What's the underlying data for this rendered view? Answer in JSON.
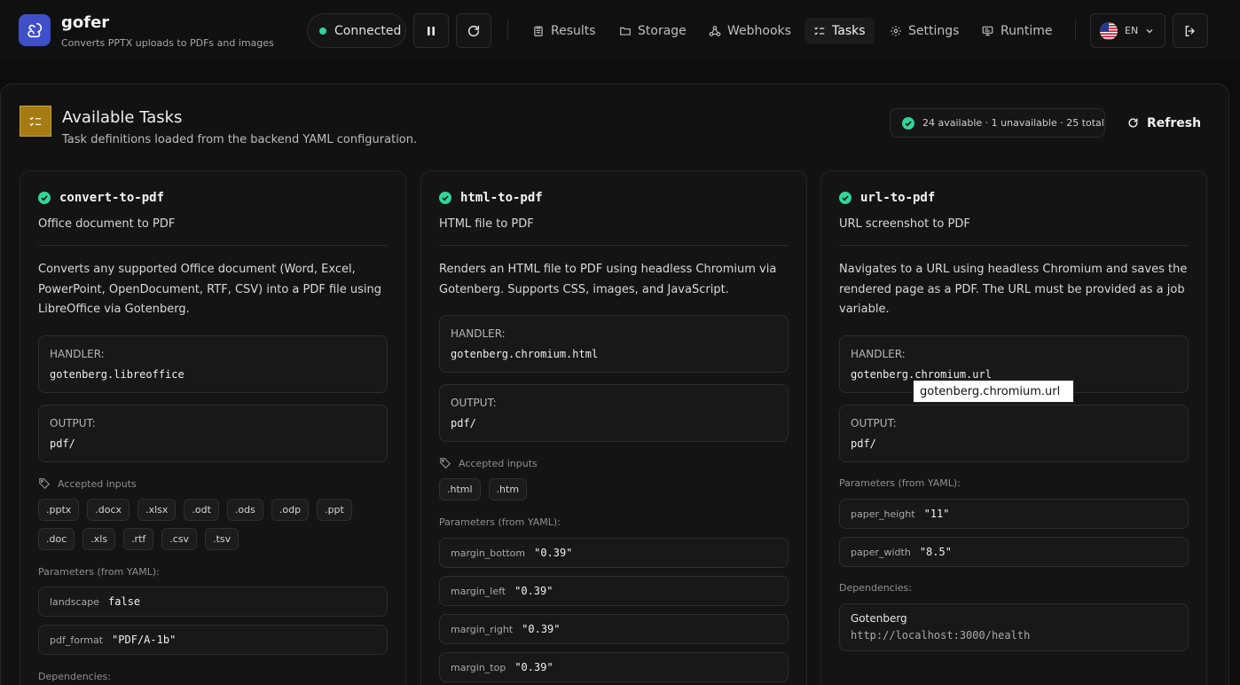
{
  "app": {
    "title": "gofer",
    "subtitle": "Converts PPTX uploads to PDFs and images"
  },
  "status": {
    "label": "Connected",
    "color": "#34d399"
  },
  "nav": [
    {
      "label": "Results",
      "icon": "clipboard-icon"
    },
    {
      "label": "Storage",
      "icon": "folder-icon"
    },
    {
      "label": "Webhooks",
      "icon": "webhook-icon"
    },
    {
      "label": "Tasks",
      "icon": "list-check-icon",
      "active": true
    },
    {
      "label": "Settings",
      "icon": "gear-icon"
    },
    {
      "label": "Runtime",
      "icon": "monitor-icon"
    }
  ],
  "language": {
    "code": "EN"
  },
  "section": {
    "title": "Available Tasks",
    "description": "Task definitions loaded from the backend YAML configuration.",
    "summary": "24 available · 1 unavailable · 25 total",
    "refresh_label": "Refresh",
    "accent": "#a47c13"
  },
  "labels": {
    "handler": "HANDLER:",
    "output": "OUTPUT:",
    "accepted_inputs": "Accepted inputs",
    "parameters": "Parameters (from YAML):",
    "dependencies": "Dependencies:"
  },
  "tasks": [
    {
      "name": "convert-to-pdf",
      "subtitle": "Office document to PDF",
      "description": "Converts any supported Office document (Word, Excel, PowerPoint, OpenDocument, RTF, CSV) into a PDF file using LibreOffice via Gotenberg.",
      "handler": "gotenberg.libreoffice",
      "output": "pdf/",
      "inputs": [
        ".pptx",
        ".docx",
        ".xlsx",
        ".odt",
        ".ods",
        ".odp",
        ".ppt",
        ".doc",
        ".xls",
        ".rtf",
        ".csv",
        ".tsv"
      ],
      "parameters": [
        {
          "key": "landscape",
          "value": "false"
        },
        {
          "key": "pdf_format",
          "value": "\"PDF/A-1b\""
        }
      ]
    },
    {
      "name": "html-to-pdf",
      "subtitle": "HTML file to PDF",
      "description": "Renders an HTML file to PDF using headless Chromium via Gotenberg. Supports CSS, images, and JavaScript.",
      "handler": "gotenberg.chromium.html",
      "output": "pdf/",
      "inputs": [
        ".html",
        ".htm"
      ],
      "parameters": [
        {
          "key": "margin_bottom",
          "value": "\"0.39\""
        },
        {
          "key": "margin_left",
          "value": "\"0.39\""
        },
        {
          "key": "margin_right",
          "value": "\"0.39\""
        },
        {
          "key": "margin_top",
          "value": "\"0.39\""
        }
      ]
    },
    {
      "name": "url-to-pdf",
      "subtitle": "URL screenshot to PDF",
      "description": "Navigates to a URL using headless Chromium and saves the rendered page as a PDF. The URL must be provided as a job variable.",
      "handler": "gotenberg.chromium.url",
      "output": "pdf/",
      "parameters": [
        {
          "key": "paper_height",
          "value": "\"11\""
        },
        {
          "key": "paper_width",
          "value": "\"8.5\""
        }
      ],
      "dependency": {
        "name": "Gotenberg",
        "url": "http://localhost:3000/health"
      }
    }
  ],
  "tooltip": {
    "text": "gotenberg.chromium.url"
  }
}
